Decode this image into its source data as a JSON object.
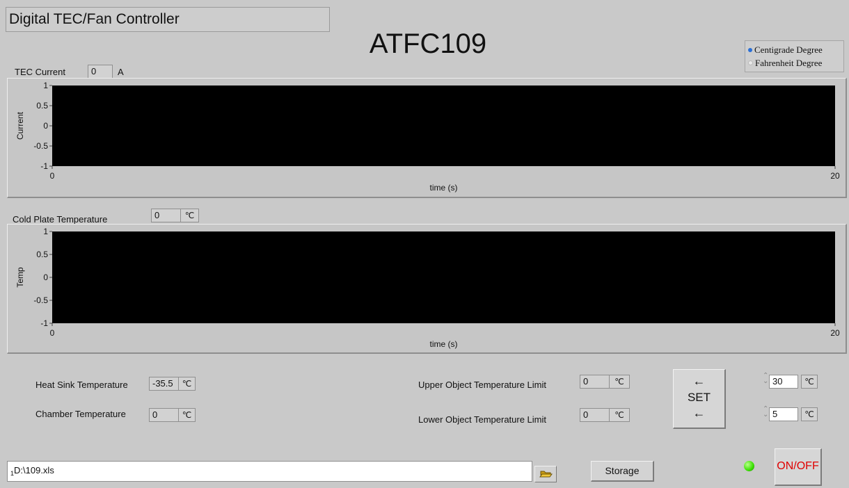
{
  "app": {
    "title": "Digital TEC/Fan Controller",
    "model": "ATFC109"
  },
  "units": {
    "options": [
      "Centigrade Degree",
      "Fahrenheit Degree"
    ],
    "selected_color": "#2a6fd6"
  },
  "tec_current": {
    "label": "TEC Current",
    "value": "0",
    "unit": "A"
  },
  "cold_plate": {
    "label": "Cold Plate Temperature",
    "value": "0",
    "unit": "℃"
  },
  "chart_data": [
    {
      "type": "line",
      "ylabel": "Current",
      "xlabel": "time (s)",
      "xlim": [
        0,
        20
      ],
      "ylim": [
        -1,
        1
      ],
      "x_ticks": [
        "0",
        "20"
      ],
      "y_ticks": [
        "1",
        "0.5",
        "0",
        "-0.5",
        "-1"
      ],
      "series": [],
      "background": "#000000"
    },
    {
      "type": "line",
      "ylabel": "Temp",
      "xlabel": "time (s)",
      "xlim": [
        0,
        20
      ],
      "ylim": [
        -1,
        1
      ],
      "x_ticks": [
        "0",
        "20"
      ],
      "y_ticks": [
        "1",
        "0.5",
        "0",
        "-0.5",
        "-1"
      ],
      "series": [],
      "background": "#000000"
    }
  ],
  "readings": {
    "heat_sink": {
      "label": "Heat Sink Temperature",
      "value": "-35.5",
      "unit": "℃"
    },
    "chamber": {
      "label": "Chamber Temperature",
      "value": "0",
      "unit": "℃"
    },
    "upper_limit": {
      "label": "Upper Object Temperature Limit",
      "value": "0",
      "unit": "℃"
    },
    "lower_limit": {
      "label": "Lower Object Temperature Limit",
      "value": "0",
      "unit": "℃"
    }
  },
  "set_button": {
    "label": "SET",
    "arrow": "←"
  },
  "setpoints": {
    "upper": {
      "value": "30",
      "unit": "℃"
    },
    "lower": {
      "value": "5",
      "unit": "℃"
    }
  },
  "file": {
    "index": "1",
    "path": "D:\\109.xls"
  },
  "storage_button": "Storage",
  "status_led_color": "#38e000",
  "power_button": {
    "label": "ON/OFF",
    "color": "#e00000"
  }
}
